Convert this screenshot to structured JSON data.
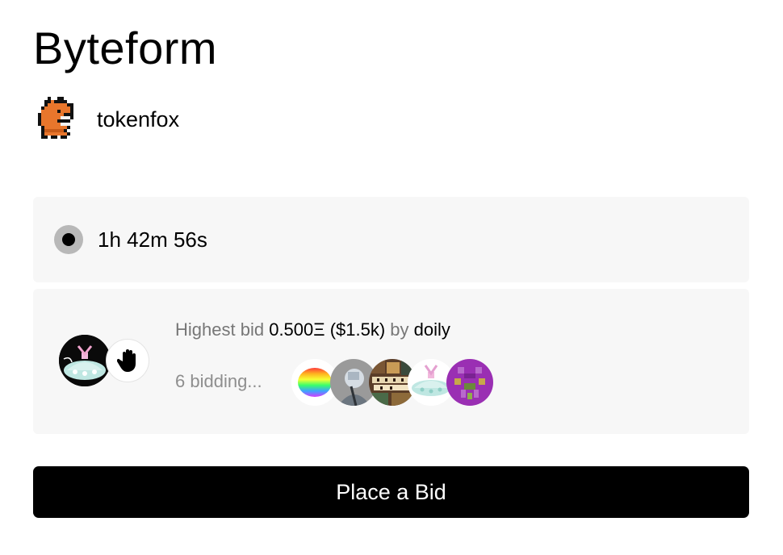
{
  "artwork": {
    "title": "Byteform"
  },
  "creator": {
    "name": "tokenfox",
    "avatar_icon": "pixel-fox-avatar"
  },
  "auction": {
    "status_icon": "live-dot-icon",
    "time_remaining": "1h 42m 56s"
  },
  "bid": {
    "label": "Highest bid",
    "amount": "0.500Ξ",
    "usd": "($1.5k)",
    "by_label": "by",
    "bidder": "doily",
    "bidding_text": "6 bidding...",
    "hand_icon": "raised-hand-icon",
    "bidders": [
      {
        "name": "rainbow-gradient-avatar"
      },
      {
        "name": "grey-portrait-avatar"
      },
      {
        "name": "mosaic-text-avatar"
      },
      {
        "name": "doily-teapot-avatar"
      },
      {
        "name": "purple-pixel-avatar"
      }
    ]
  },
  "actions": {
    "place_bid": "Place a Bid"
  }
}
